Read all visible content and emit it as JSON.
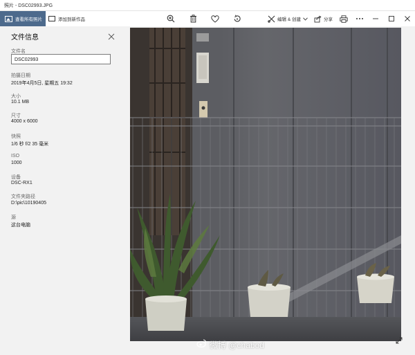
{
  "window": {
    "title": "照片 - DSC02993.JPG"
  },
  "toolbar": {
    "all_photos_label": "查看所有照片",
    "add_to_creation_label": "添加到新作品",
    "edit_create_label": "编辑 & 创建",
    "share_label": "分享",
    "icons": [
      "zoom-in-icon",
      "delete-icon",
      "favorite-heart-icon",
      "rotate-icon",
      "edit-create-icon",
      "share-icon",
      "print-icon",
      "more-icon"
    ]
  },
  "info_panel": {
    "title": "文件信息",
    "filename_label": "文件名",
    "filename_value": "DSC02993",
    "date_label": "拍摄日期",
    "date_value": "2019年4月5日, 星期五 19:32",
    "size_label": "大小",
    "size_value": "10.1 MB",
    "dimensions_label": "尺寸",
    "dimensions_value": "4000 x 6000",
    "shutter_label": "快照",
    "shutter_value": "1/6 秒 f/2 35 毫米",
    "iso_label": "ISO",
    "iso_value": "1000",
    "device_label": "设备",
    "device_value": "DSC-RX1",
    "folder_label": "文件夹路径",
    "folder_value": "D:\\pic\\10190405",
    "source_label": "源",
    "source_value": "这台电脑"
  },
  "watermark": {
    "text": "微博 @chabod"
  },
  "colors": {
    "accent": "#4d6a8c",
    "panel_bg": "#f2f2f2",
    "toolbar_bg": "#ffffff"
  }
}
